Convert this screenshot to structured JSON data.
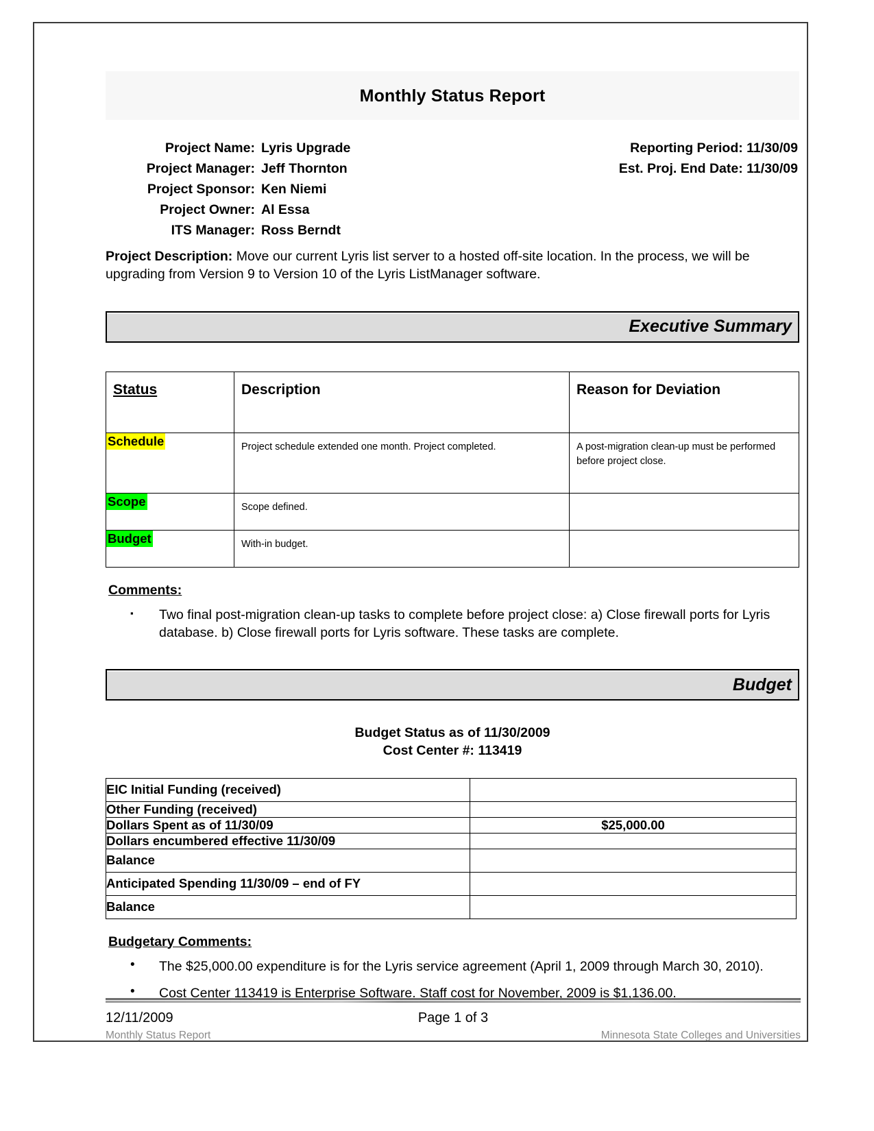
{
  "document": {
    "title": "Monthly Status Report"
  },
  "project_info": {
    "fields": [
      {
        "label": "Project Name:",
        "value": "Lyris Upgrade"
      },
      {
        "label": "Project Manager:",
        "value": "Jeff Thornton"
      },
      {
        "label": "Project Sponsor:",
        "value": "Ken Niemi"
      },
      {
        "label": "Project Owner:",
        "value": "Al Essa"
      },
      {
        "label": "ITS Manager:",
        "value": "Ross Berndt"
      }
    ],
    "reporting_period_label": "Reporting Period:",
    "reporting_period_value": "11/30/09",
    "est_end_date_label": "Est. Proj. End Date:",
    "est_end_date_value": "11/30/09",
    "description_label": "Project Description:",
    "description_text": "Move our current Lyris list server to a hosted off-site location.  In the process, we will be upgrading from Version 9 to Version 10 of the Lyris ListManager software."
  },
  "executive_summary": {
    "section_title": "Executive Summary",
    "columns": [
      "Status",
      "Description",
      "Reason for Deviation"
    ],
    "rows": [
      {
        "status": "Schedule",
        "highlight": "#ffff00",
        "description": "Project schedule extended one month.   Project completed.",
        "reason": "A post-migration clean-up must be performed before project close."
      },
      {
        "status": "Scope",
        "highlight": "#00ff00",
        "description": "Scope defined.",
        "reason": ""
      },
      {
        "status": "Budget",
        "highlight": "#00ff00",
        "description": "With-in budget.",
        "reason": ""
      }
    ],
    "comments_label": "Comments:",
    "comments": [
      "Two final post-migration clean-up tasks to complete before project close:  a) Close firewall ports for Lyris database.  b) Close firewall ports for Lyris software.  These tasks are complete."
    ]
  },
  "budget": {
    "section_title": "Budget",
    "heading_line1": "Budget Status as of 11/30/2009",
    "heading_line2": "Cost Center #: 113419",
    "rows": [
      {
        "label": "EIC Initial Funding (received)",
        "value": ""
      },
      {
        "label": "Other Funding (received)",
        "value": ""
      },
      {
        "label": "Dollars Spent as of 11/30/09",
        "value": "$25,000.00"
      },
      {
        "label": "Dollars encumbered effective 11/30/09",
        "value": ""
      },
      {
        "label": "Balance",
        "value": ""
      },
      {
        "label": "Anticipated Spending 11/30/09 – end of FY",
        "value": ""
      },
      {
        "label": "Balance",
        "value": ""
      }
    ],
    "comments_label": "Budgetary Comments:",
    "comments": [
      "The $25,000.00 expenditure is for the Lyris service agreement (April 1, 2009 through March 30, 2010).",
      "Cost Center 113419 is Enterprise Software.  Staff cost for November, 2009 is $1,136.00."
    ]
  },
  "footer": {
    "date": "12/11/2009",
    "page": "Page 1 of 3",
    "document_name": "Monthly Status Report",
    "organization": "Minnesota State Colleges and Universities"
  }
}
